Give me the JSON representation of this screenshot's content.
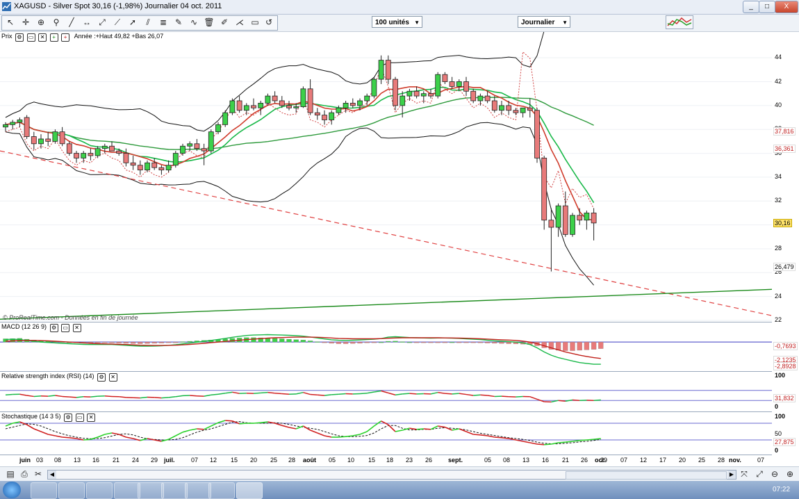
{
  "window": {
    "title": "XAGUSD - Silver Spot   30,16 (-1,98%)   Journalier  04 oct. 2011",
    "controls": [
      "_",
      "□",
      "X"
    ]
  },
  "toolbar": {
    "units_select": "100 unités",
    "period_select": "Journalier",
    "icons": [
      "cursor-icon",
      "crosshair-icon",
      "zoom-icon",
      "line-icon",
      "horizontal-line-icon",
      "segment-icon",
      "trend-tool-icon",
      "arrow-tool-icon",
      "channel-icon",
      "fibonacci-icon",
      "text-icon",
      "trash-icon",
      "pencil-icon",
      "fan-icon",
      "rectangle-icon",
      "undo-icon",
      "layout-icon"
    ]
  },
  "panes": {
    "price": {
      "label": "Prix",
      "annotation": "Année :+Haut 49,82 +Bas 26,07",
      "watermark": "© ProRealTime.com - Données en fin de journée",
      "tags": {
        "upper_ma": "37,816",
        "mid_ma": "36,361",
        "price": "30,16",
        "lower_band": "26,479"
      }
    },
    "macd": {
      "label": "MACD (12 26 9)",
      "tags": [
        "-0,7693",
        "-2,1235",
        "-2,8928"
      ]
    },
    "rsi": {
      "label": "Relative strength index (RSI) (14)",
      "tags": [
        "100",
        "31,832",
        "0"
      ]
    },
    "stoch": {
      "label": "Stochastique (14 3 5)",
      "tags": [
        "100",
        "50",
        "27,875",
        "0"
      ]
    }
  },
  "chart_data": [
    {
      "type": "candlestick",
      "title": "XAGUSD - Silver Spot",
      "ylim": [
        22,
        45
      ],
      "yticks": [
        22,
        24,
        26,
        28,
        30,
        32,
        34,
        36,
        38,
        40,
        42,
        44
      ],
      "xlabels": [
        "juin",
        "03",
        "08",
        "13",
        "16",
        "21",
        "24",
        "29",
        "juil.",
        "07",
        "12",
        "15",
        "20",
        "25",
        "28",
        "août",
        "05",
        "10",
        "15",
        "18",
        "23",
        "26",
        "sept.",
        "05",
        "08",
        "13",
        "16",
        "21",
        "26",
        "29",
        "oct.",
        "07",
        "12",
        "17",
        "20",
        "25",
        "28",
        "nov.",
        "07"
      ],
      "ohlc": [
        [
          38.2,
          38.6,
          37.8,
          38.4
        ],
        [
          38.4,
          38.8,
          38.0,
          38.6
        ],
        [
          38.6,
          39.0,
          38.2,
          38.8
        ],
        [
          39.0,
          39.2,
          37.2,
          37.4
        ],
        [
          37.4,
          37.8,
          36.3,
          36.8
        ],
        [
          36.8,
          37.6,
          36.4,
          37.2
        ],
        [
          37.2,
          37.8,
          36.6,
          37.0
        ],
        [
          37.0,
          38.0,
          36.8,
          37.8
        ],
        [
          37.8,
          38.2,
          36.6,
          36.8
        ],
        [
          36.8,
          37.0,
          35.8,
          36.0
        ],
        [
          36.0,
          36.2,
          35.2,
          35.6
        ],
        [
          35.6,
          36.2,
          35.2,
          36.0
        ],
        [
          36.0,
          36.4,
          35.4,
          35.8
        ],
        [
          35.8,
          36.6,
          35.6,
          36.4
        ],
        [
          36.4,
          36.8,
          36.0,
          36.6
        ],
        [
          36.6,
          37.0,
          36.2,
          36.2
        ],
        [
          36.2,
          36.4,
          35.8,
          36.0
        ],
        [
          36.0,
          36.4,
          34.9,
          35.2
        ],
        [
          35.2,
          35.8,
          34.6,
          35.0
        ],
        [
          35.0,
          35.4,
          34.2,
          34.6
        ],
        [
          34.6,
          35.4,
          34.4,
          35.2
        ],
        [
          35.2,
          35.6,
          34.6,
          34.8
        ],
        [
          34.8,
          35.0,
          34.2,
          34.6
        ],
        [
          34.6,
          35.4,
          34.4,
          35.0
        ],
        [
          35.0,
          36.2,
          34.8,
          36.0
        ],
        [
          36.0,
          36.8,
          35.8,
          36.6
        ],
        [
          36.6,
          37.0,
          36.2,
          36.8
        ],
        [
          36.8,
          37.2,
          36.2,
          36.4
        ],
        [
          36.4,
          36.8,
          35.0,
          36.2
        ],
        [
          36.2,
          38.0,
          36.0,
          37.8
        ],
        [
          37.8,
          38.6,
          37.6,
          38.4
        ],
        [
          38.4,
          39.6,
          38.2,
          39.4
        ],
        [
          39.4,
          40.6,
          39.2,
          40.4
        ],
        [
          40.4,
          40.8,
          39.4,
          39.6
        ],
        [
          39.6,
          40.2,
          39.2,
          40.0
        ],
        [
          40.0,
          40.6,
          39.6,
          39.8
        ],
        [
          39.8,
          40.4,
          39.2,
          40.2
        ],
        [
          40.2,
          41.0,
          40.0,
          40.8
        ],
        [
          40.8,
          41.2,
          40.2,
          40.4
        ],
        [
          40.4,
          40.8,
          39.8,
          40.0
        ],
        [
          40.0,
          40.4,
          39.6,
          39.8
        ],
        [
          39.8,
          40.2,
          39.4,
          39.9
        ],
        [
          39.9,
          41.6,
          39.8,
          41.4
        ],
        [
          41.4,
          42.2,
          39.2,
          39.4
        ],
        [
          39.4,
          39.8,
          38.8,
          39.2
        ],
        [
          39.2,
          39.6,
          38.4,
          38.8
        ],
        [
          38.8,
          39.6,
          38.4,
          39.4
        ],
        [
          39.4,
          40.0,
          39.2,
          39.8
        ],
        [
          39.8,
          40.4,
          39.4,
          40.2
        ],
        [
          40.2,
          40.6,
          39.8,
          40.0
        ],
        [
          40.0,
          40.6,
          39.6,
          40.4
        ],
        [
          40.4,
          41.0,
          40.0,
          40.8
        ],
        [
          40.8,
          42.4,
          40.6,
          42.2
        ],
        [
          42.2,
          44.2,
          41.8,
          43.8
        ],
        [
          43.8,
          44.2,
          41.8,
          42.2
        ],
        [
          42.2,
          42.4,
          39.6,
          40.0
        ],
        [
          40.0,
          41.2,
          39.0,
          40.8
        ],
        [
          40.8,
          41.4,
          40.4,
          41.2
        ],
        [
          41.2,
          41.6,
          40.6,
          40.8
        ],
        [
          40.8,
          41.2,
          40.2,
          41.0
        ],
        [
          41.0,
          41.4,
          40.6,
          40.8
        ],
        [
          40.8,
          42.8,
          40.6,
          42.6
        ],
        [
          42.6,
          42.8,
          41.8,
          42.0
        ],
        [
          42.0,
          42.4,
          41.4,
          41.6
        ],
        [
          41.6,
          42.2,
          41.2,
          42.0
        ],
        [
          42.0,
          42.4,
          40.8,
          41.2
        ],
        [
          41.2,
          41.4,
          40.2,
          40.4
        ],
        [
          40.4,
          41.0,
          40.0,
          40.8
        ],
        [
          40.8,
          41.2,
          40.2,
          40.4
        ],
        [
          40.4,
          40.8,
          39.4,
          39.6
        ],
        [
          39.6,
          40.4,
          39.2,
          40.0
        ],
        [
          40.0,
          40.4,
          39.2,
          39.6
        ],
        [
          39.6,
          39.8,
          39.2,
          39.4
        ],
        [
          39.4,
          39.8,
          39.0,
          39.8
        ],
        [
          39.8,
          40.6,
          39.0,
          39.6
        ],
        [
          39.6,
          39.8,
          35.2,
          35.6
        ],
        [
          35.6,
          35.8,
          29.6,
          30.4
        ],
        [
          30.4,
          31.4,
          26.1,
          29.8
        ],
        [
          29.8,
          31.8,
          29.0,
          31.6
        ],
        [
          31.6,
          32.8,
          29.0,
          29.2
        ],
        [
          29.2,
          31.0,
          29.0,
          30.8
        ],
        [
          30.8,
          31.4,
          30.0,
          30.4
        ],
        [
          30.4,
          31.2,
          29.6,
          31.0
        ],
        [
          31.0,
          31.4,
          28.7,
          30.16
        ]
      ],
      "series_markers": [
        "bollinger-upper",
        "bollinger-lower",
        "moving-average",
        "moving-average-long",
        "parabolic-sar",
        "support-trendline",
        "resistance-trendline"
      ]
    },
    {
      "type": "bar",
      "title": "MACD (12 26 9)",
      "ylim": [
        -3.2,
        1.2
      ],
      "histogram": [
        0.4,
        0.42,
        0.45,
        0.35,
        0.25,
        0.2,
        0.15,
        0.1,
        0.05,
        0.0,
        -0.05,
        -0.08,
        -0.1,
        -0.1,
        -0.08,
        -0.1,
        -0.12,
        -0.15,
        -0.18,
        -0.2,
        -0.18,
        -0.15,
        -0.12,
        -0.08,
        -0.02,
        0.05,
        0.1,
        0.15,
        0.2,
        0.25,
        0.3,
        0.38,
        0.45,
        0.5,
        0.55,
        0.55,
        0.52,
        0.5,
        0.45,
        0.4,
        0.35,
        0.3,
        0.25,
        0.15,
        0.05,
        -0.05,
        -0.15,
        -0.2,
        -0.2,
        -0.18,
        -0.15,
        -0.1,
        -0.05,
        0.0,
        0.1,
        0.12,
        0.05,
        0.0,
        -0.02,
        -0.05,
        -0.08,
        -0.05,
        -0.02,
        0.0,
        -0.02,
        -0.05,
        -0.08,
        -0.1,
        -0.12,
        -0.15,
        -0.18,
        -0.2,
        -0.22,
        -0.25,
        -0.3,
        -0.45,
        -0.7,
        -0.9,
        -1.0,
        -1.05,
        -1.05,
        -1.0,
        -0.95,
        -0.9,
        -0.8
      ],
      "macd": [
        0.3,
        0.35,
        0.3,
        0.2,
        0.1,
        0.0,
        -0.05,
        -0.1,
        -0.15,
        -0.2,
        -0.25,
        -0.28,
        -0.3,
        -0.3,
        -0.28,
        -0.3,
        -0.35,
        -0.4,
        -0.45,
        -0.5,
        -0.5,
        -0.48,
        -0.45,
        -0.4,
        -0.32,
        -0.22,
        -0.12,
        -0.02,
        0.1,
        0.2,
        0.32,
        0.45,
        0.58,
        0.7,
        0.8,
        0.85,
        0.88,
        0.9,
        0.88,
        0.85,
        0.82,
        0.78,
        0.72,
        0.62,
        0.5,
        0.38,
        0.28,
        0.22,
        0.2,
        0.22,
        0.25,
        0.3,
        0.35,
        0.42,
        0.6,
        0.65,
        0.6,
        0.55,
        0.52,
        0.5,
        0.48,
        0.5,
        0.5,
        0.48,
        0.45,
        0.4,
        0.35,
        0.3,
        0.22,
        0.15,
        0.1,
        0.05,
        0.0,
        -0.1,
        -0.3,
        -0.7,
        -1.2,
        -1.6,
        -1.9,
        -2.1,
        -2.3,
        -2.5,
        -2.6,
        -2.7,
        -2.7
      ],
      "signal": [
        0.1,
        0.14,
        0.18,
        0.2,
        0.2,
        0.18,
        0.15,
        0.1,
        0.05,
        0.0,
        -0.05,
        -0.1,
        -0.15,
        -0.2,
        -0.22,
        -0.25,
        -0.28,
        -0.3,
        -0.34,
        -0.38,
        -0.4,
        -0.42,
        -0.42,
        -0.4,
        -0.38,
        -0.34,
        -0.28,
        -0.22,
        -0.15,
        -0.08,
        0.0,
        0.08,
        0.15,
        0.22,
        0.3,
        0.36,
        0.42,
        0.48,
        0.52,
        0.55,
        0.58,
        0.6,
        0.6,
        0.6,
        0.58,
        0.55,
        0.5,
        0.45,
        0.42,
        0.4,
        0.4,
        0.4,
        0.4,
        0.42,
        0.46,
        0.5,
        0.52,
        0.52,
        0.52,
        0.52,
        0.52,
        0.52,
        0.51,
        0.5,
        0.48,
        0.46,
        0.43,
        0.4,
        0.36,
        0.32,
        0.28,
        0.24,
        0.2,
        0.12,
        0.0,
        -0.2,
        -0.45,
        -0.7,
        -0.95,
        -1.2,
        -1.4,
        -1.6,
        -1.75,
        -1.9,
        -2.0
      ]
    },
    {
      "type": "line",
      "title": "Relative strength index (RSI) (14)",
      "ylim": [
        0,
        100
      ],
      "levels": [
        30,
        70
      ],
      "values": [
        52,
        54,
        55,
        50,
        46,
        48,
        47,
        50,
        46,
        44,
        42,
        45,
        44,
        47,
        48,
        46,
        45,
        42,
        41,
        40,
        43,
        42,
        40,
        42,
        45,
        49,
        50,
        48,
        47,
        52,
        55,
        59,
        63,
        58,
        59,
        58,
        60,
        62,
        59,
        57,
        55,
        56,
        62,
        54,
        52,
        50,
        53,
        55,
        57,
        56,
        57,
        59,
        64,
        68,
        60,
        52,
        56,
        58,
        56,
        57,
        56,
        62,
        58,
        56,
        58,
        54,
        50,
        52,
        50,
        46,
        47,
        45,
        44,
        46,
        45,
        35,
        25,
        24,
        30,
        27,
        32,
        30,
        31,
        30,
        31.8
      ]
    },
    {
      "type": "line",
      "title": "Stochastique (14 3 5)",
      "ylim": [
        0,
        100
      ],
      "levels": [
        20,
        80
      ],
      "k": [
        70,
        80,
        85,
        75,
        60,
        50,
        40,
        35,
        30,
        28,
        25,
        20,
        22,
        30,
        40,
        45,
        40,
        30,
        25,
        18,
        25,
        20,
        15,
        22,
        35,
        48,
        55,
        60,
        58,
        70,
        82,
        90,
        88,
        78,
        80,
        80,
        82,
        85,
        80,
        72,
        65,
        60,
        70,
        55,
        45,
        35,
        30,
        30,
        32,
        35,
        40,
        50,
        70,
        88,
        75,
        50,
        55,
        62,
        58,
        60,
        58,
        70,
        66,
        55,
        60,
        50,
        40,
        38,
        35,
        30,
        28,
        25,
        20,
        15,
        10,
        5,
        3,
        5,
        10,
        12,
        15,
        18,
        20,
        22,
        25
      ],
      "d": [
        60,
        66,
        72,
        78,
        76,
        70,
        60,
        50,
        42,
        35,
        30,
        26,
        24,
        25,
        28,
        34,
        40,
        42,
        38,
        30,
        24,
        22,
        20,
        20,
        22,
        28,
        38,
        48,
        55,
        60,
        68,
        76,
        84,
        86,
        82,
        80,
        80,
        80,
        82,
        80,
        76,
        70,
        66,
        62,
        58,
        50,
        42,
        35,
        32,
        32,
        33,
        36,
        45,
        60,
        72,
        72,
        62,
        56,
        56,
        58,
        58,
        62,
        64,
        62,
        60,
        56,
        50,
        44,
        40,
        36,
        32,
        28,
        25,
        22,
        18,
        12,
        8,
        6,
        6,
        8,
        10,
        13,
        15,
        18,
        22
      ]
    }
  ]
}
